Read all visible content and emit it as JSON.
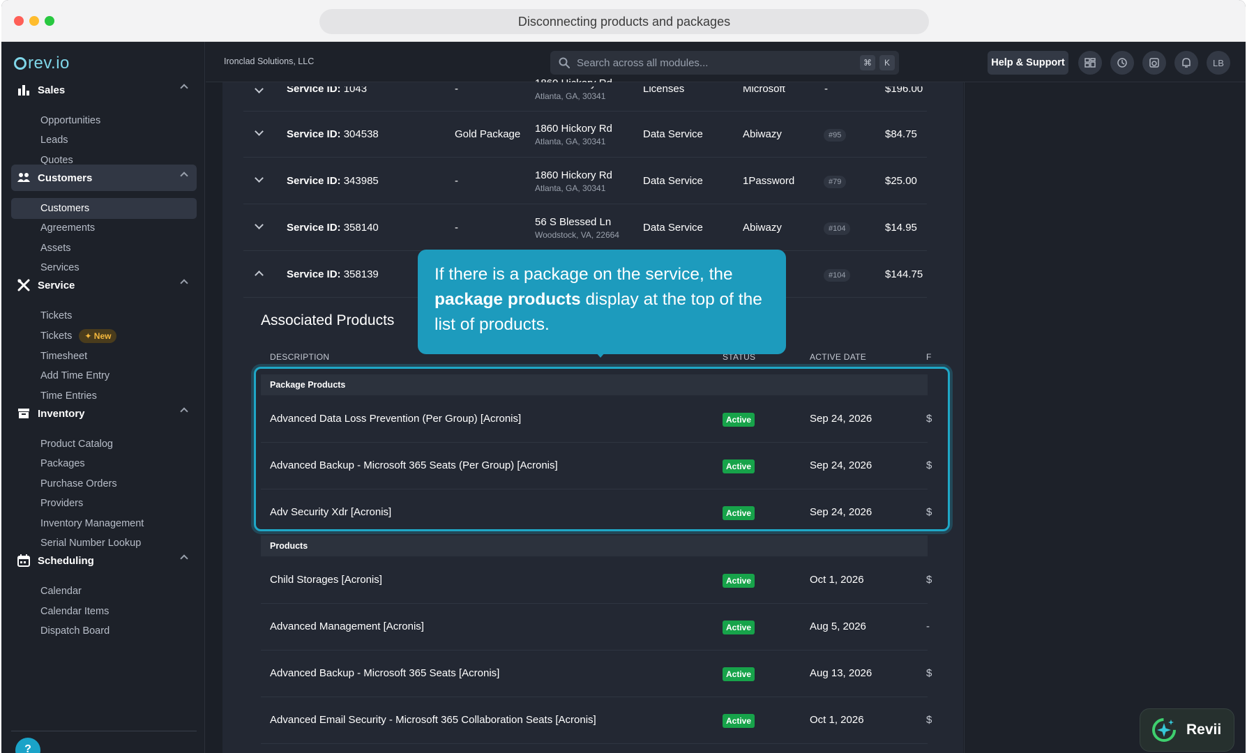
{
  "window": {
    "title": "Disconnecting products and packages"
  },
  "brand": {
    "logo_text": "rev.io"
  },
  "sidebar": {
    "sections": [
      {
        "label": "Sales",
        "icon": "bar-chart-icon",
        "items": [
          "Opportunities",
          "Leads",
          "Quotes"
        ]
      },
      {
        "label": "Customers",
        "icon": "users-icon",
        "items": [
          "Customers",
          "Agreements",
          "Assets",
          "Services"
        ]
      },
      {
        "label": "Service",
        "icon": "tools-icon",
        "items": [
          "Tickets",
          "Tickets",
          "Timesheet",
          "Add Time Entry",
          "Time Entries"
        ]
      },
      {
        "label": "Inventory",
        "icon": "archive-icon",
        "items": [
          "Product Catalog",
          "Packages",
          "Purchase Orders",
          "Providers",
          "Inventory Management",
          "Serial Number Lookup"
        ]
      },
      {
        "label": "Scheduling",
        "icon": "calendar-icon",
        "items": [
          "Calendar",
          "Calendar Items",
          "Dispatch Board"
        ]
      }
    ],
    "new_badge": "New",
    "help_bubble": "?"
  },
  "topbar": {
    "company": "Ironclad Solutions, LLC",
    "search_placeholder": "Search across all modules...",
    "shortcut_keys": [
      "⌘",
      "K"
    ],
    "help_button": "Help & Support",
    "avatar_initials": "LB"
  },
  "services": [
    {
      "id_label": "Service ID:",
      "id": "1043",
      "package": "-",
      "address": "1860 Hickory Rd",
      "city": "Atlanta, GA, 30341",
      "type": "Licenses",
      "vendor": "Microsoft",
      "tag": "-",
      "price": "$196.00"
    },
    {
      "id_label": "Service ID:",
      "id": "304538",
      "package": "Gold Package",
      "address": "1860 Hickory Rd",
      "city": "Atlanta, GA, 30341",
      "type": "Data Service",
      "vendor": "Abiwazy",
      "tag": "#95",
      "price": "$84.75"
    },
    {
      "id_label": "Service ID:",
      "id": "343985",
      "package": "-",
      "address": "1860 Hickory Rd",
      "city": "Atlanta, GA, 30341",
      "type": "Data Service",
      "vendor": "1Password",
      "tag": "#79",
      "price": "$25.00"
    },
    {
      "id_label": "Service ID:",
      "id": "358140",
      "package": "-",
      "address": "56 S Blessed Ln",
      "city": "Woodstock, VA, 22664",
      "type": "Data Service",
      "vendor": "Abiwazy",
      "tag": "#104",
      "price": "$14.95"
    },
    {
      "id_label": "Service ID:",
      "id": "358139",
      "tag": "#104",
      "price": "$144.75"
    }
  ],
  "associated": {
    "title": "Associated Products",
    "columns": {
      "description": "DESCRIPTION",
      "status": "STATUS",
      "active_date": "ACTIVE DATE",
      "edge": "F"
    },
    "package_group": "Package Products",
    "package_products": [
      {
        "desc": "Advanced Data Loss Prevention (Per Group) [Acronis]",
        "status": "Active",
        "date": "Sep 24, 2026",
        "edge": "$"
      },
      {
        "desc": "Advanced Backup - Microsoft 365 Seats (Per Group) [Acronis]",
        "status": "Active",
        "date": "Sep 24, 2026",
        "edge": "$"
      },
      {
        "desc": "Adv Security Xdr [Acronis]",
        "status": "Active",
        "date": "Sep 24, 2026",
        "edge": "$"
      }
    ],
    "products_group": "Products",
    "products": [
      {
        "desc": "Child Storages [Acronis]",
        "status": "Active",
        "date": "Oct 1, 2026",
        "edge": "$"
      },
      {
        "desc": "Advanced Management [Acronis]",
        "status": "Active",
        "date": "Aug 5, 2026",
        "edge": "-"
      },
      {
        "desc": "Advanced Backup - Microsoft 365 Seats [Acronis]",
        "status": "Active",
        "date": "Aug 13, 2026",
        "edge": "$"
      },
      {
        "desc": "Advanced Email Security - Microsoft 365 Collaboration Seats [Acronis]",
        "status": "Active",
        "date": "Oct 1, 2026",
        "edge": "$"
      }
    ]
  },
  "callout": {
    "text_before": "If there is a package on the service, the",
    "text_bold": "package products",
    "text_after": "display at the top of the list of products."
  },
  "assistant": {
    "label": "Revii"
  },
  "colors": {
    "accent": "#1d9bbd",
    "active_green": "#17a34a",
    "background": "#1b1f27"
  }
}
